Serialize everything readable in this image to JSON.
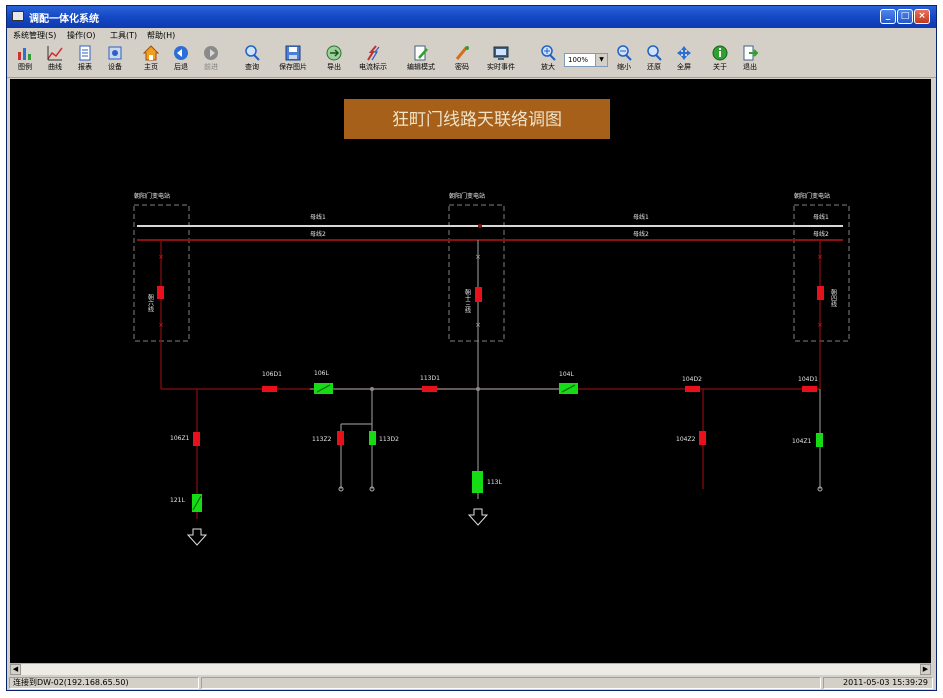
{
  "window": {
    "title": "调配一体化系统"
  },
  "menu": [
    "系统管理(S)",
    "操作(O)",
    "工具(T)",
    "帮助(H)"
  ],
  "toolbar": {
    "items": [
      {
        "label": "图例",
        "icon": "legend-icon"
      },
      {
        "label": "曲线",
        "icon": "curve-chart-icon"
      },
      {
        "label": "报表",
        "icon": "report-icon"
      },
      {
        "label": "设备",
        "icon": "device-icon"
      },
      {
        "label": "主页",
        "icon": "home-icon"
      },
      {
        "label": "后退",
        "icon": "back-arrow-icon"
      },
      {
        "label": "前进",
        "icon": "forward-arrow-icon"
      },
      {
        "label": "查询",
        "icon": "magnifier-icon"
      },
      {
        "label": "保存图片",
        "icon": "save-image-icon"
      },
      {
        "label": "导出",
        "icon": "export-icon"
      },
      {
        "label": "电流标示",
        "icon": "current-flow-icon"
      },
      {
        "label": "编辑模式",
        "icon": "edit-pen-icon"
      },
      {
        "label": "密码",
        "icon": "password-icon"
      },
      {
        "label": "实时事件",
        "icon": "realtime-event-icon"
      },
      {
        "label": "放大",
        "icon": "zoom-in-icon"
      },
      {
        "label": "缩小",
        "icon": "zoom-out-icon"
      },
      {
        "label": "还原",
        "icon": "restore-icon"
      },
      {
        "label": "全屏",
        "icon": "fullscreen-icon"
      },
      {
        "label": "关于",
        "icon": "about-icon"
      },
      {
        "label": "退出",
        "icon": "exit-icon"
      }
    ],
    "zoom_value": "100%"
  },
  "diagram": {
    "title": "狂町门线路天联络调图",
    "substations": [
      "朝阳门变电站",
      "朝阳门变电站",
      "朝阳门变电站"
    ],
    "bus_labels": [
      "母线1",
      "母线1",
      "母线1",
      "母线2",
      "母线2",
      "母线2"
    ],
    "feeders": [
      "朝六线",
      "朝十三线",
      "朝四线"
    ],
    "switch_labels": [
      "106D1",
      "106L",
      "113D1",
      "104L",
      "104D2",
      "104D1",
      "106Z1",
      "113Z2",
      "113D2",
      "104Z2",
      "104Z1",
      "121L",
      "113L"
    ],
    "colors": {
      "closed": "#e8111b",
      "open": "#16dc16",
      "bus": "#d8d8d8",
      "line": "#8a0f0f",
      "title_bg": "#a7601a"
    }
  },
  "status": {
    "connection": "连接到DW-02(192.168.65.50)",
    "datetime": "2011-05-03 15:39:29"
  }
}
